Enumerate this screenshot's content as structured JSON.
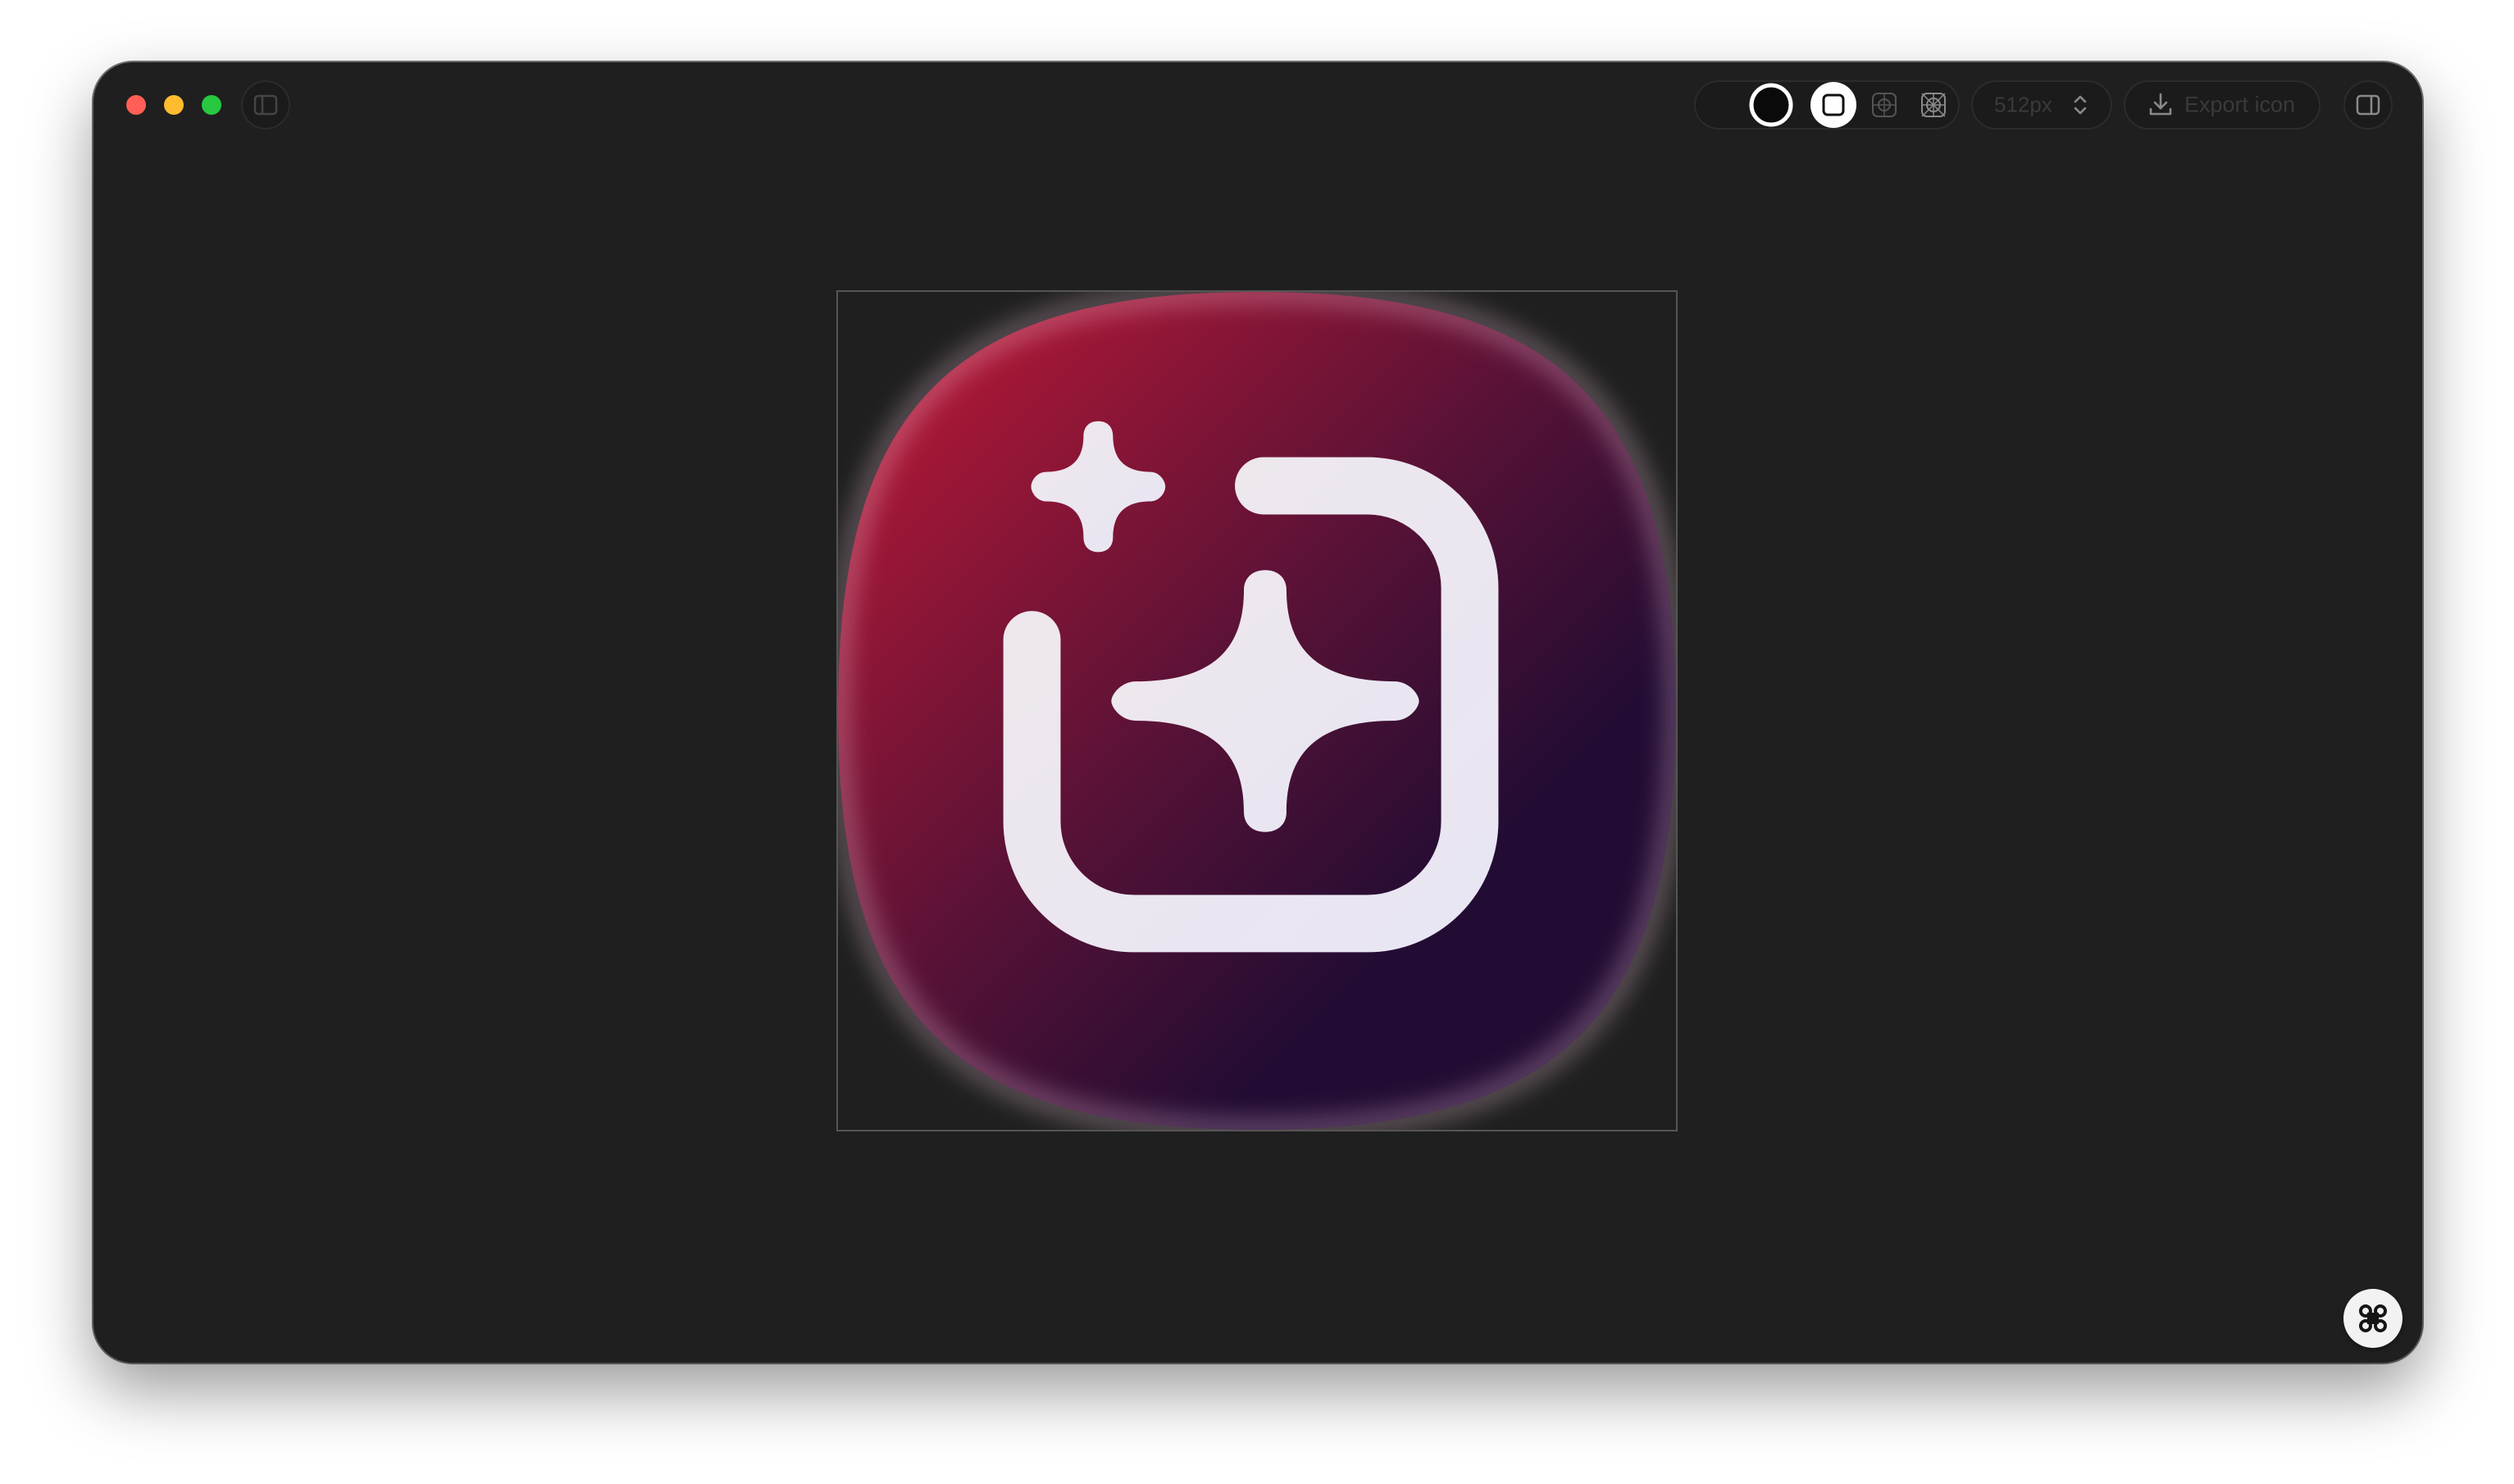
{
  "window": {
    "traffic_lights": [
      {
        "name": "close",
        "color": "#ff5f57"
      },
      {
        "name": "minimize",
        "color": "#febc2e"
      },
      {
        "name": "zoom",
        "color": "#28c840"
      }
    ]
  },
  "toolbar": {
    "left_sidebar_icon": "sidebar-left-icon",
    "shape_options": [
      {
        "name": "circle",
        "icon": "circle-shape-icon",
        "selected": false
      },
      {
        "name": "rounded-square",
        "icon": "rounded-square-shape-icon",
        "selected": true
      },
      {
        "name": "grid",
        "icon": "grid-guide-icon",
        "selected": false
      },
      {
        "name": "icon-grid",
        "icon": "icon-grid-guide-icon",
        "selected": false
      }
    ],
    "size_value": "512px",
    "size_stepper_icon": "chevron-up-down-icon",
    "export_label": "Export icon",
    "export_icon": "download-icon",
    "right_sidebar_icon": "sidebar-right-icon"
  },
  "canvas": {
    "icon_gradient": {
      "start": "#c41935",
      "middle": "#5a1236",
      "end": "#230c33"
    },
    "glyph": "sparkles-in-frame-icon",
    "glyph_color": "#ece6ee"
  },
  "fab_icon": "command-icon",
  "colors": {
    "window_bg": "#1f1f1f",
    "control_border": "#2c2c2c",
    "dim_text": "#3a3a3a"
  }
}
